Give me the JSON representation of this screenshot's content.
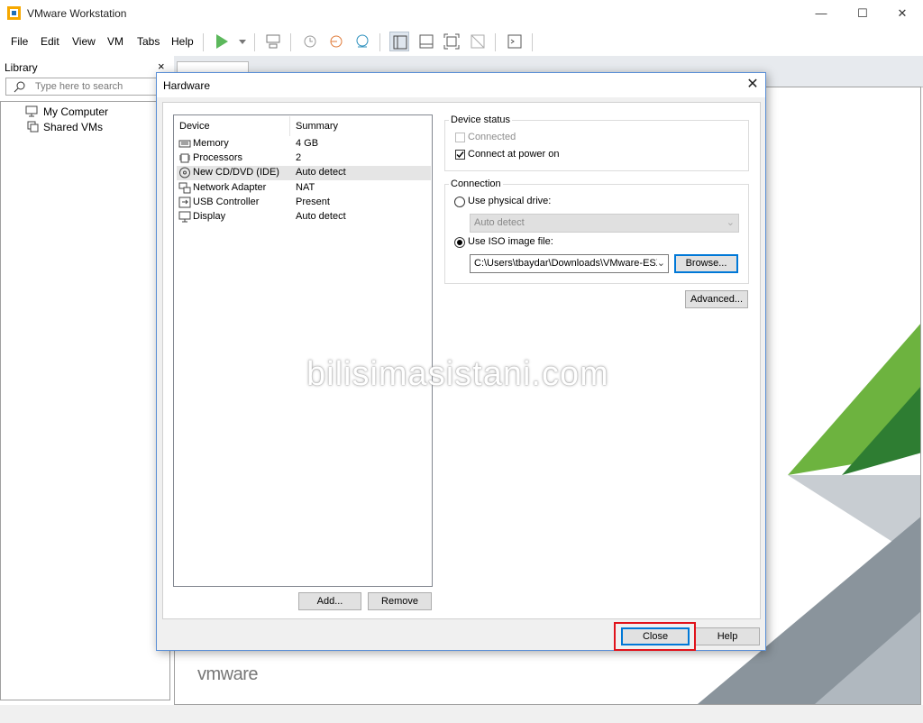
{
  "window": {
    "title": "VMware Workstation",
    "minimize_icon": "minimize-icon",
    "maximize_icon": "maximize-icon",
    "close_icon": "close-icon"
  },
  "menu": [
    "File",
    "Edit",
    "View",
    "VM",
    "Tabs",
    "Help"
  ],
  "library": {
    "title": "Library",
    "close_glyph": "×",
    "search_placeholder": "Type here to search",
    "items": [
      "My Computer",
      "Shared VMs"
    ]
  },
  "main": {
    "logo_text": "vmware",
    "watermark": "bilisimasistani.com",
    "colors": {
      "green_light": "#6db33f",
      "green_dark": "#2e7d32",
      "grey_light": "#c8cdd2",
      "grey_dark": "#8a949c"
    }
  },
  "dialog": {
    "title": "Hardware",
    "close_glyph": "✕",
    "columns": {
      "device": "Device",
      "summary": "Summary"
    },
    "devices": [
      {
        "name": "Memory",
        "summary": "4 GB",
        "icon": "memory-icon",
        "selected": false
      },
      {
        "name": "Processors",
        "summary": "2",
        "icon": "processor-icon",
        "selected": false
      },
      {
        "name": "New CD/DVD (IDE)",
        "summary": "Auto detect",
        "icon": "cd-dvd-icon",
        "selected": true
      },
      {
        "name": "Network Adapter",
        "summary": "NAT",
        "icon": "network-icon",
        "selected": false
      },
      {
        "name": "USB Controller",
        "summary": "Present",
        "icon": "usb-icon",
        "selected": false
      },
      {
        "name": "Display",
        "summary": "Auto detect",
        "icon": "display-icon",
        "selected": false
      }
    ],
    "add_label": "Add...",
    "remove_label": "Remove",
    "device_status": {
      "title": "Device status",
      "connected_label": "Connected",
      "connected_checked": false,
      "connect_power_label": "Connect at power on",
      "connect_power_checked": true
    },
    "connection": {
      "title": "Connection",
      "physical_label": "Use physical drive:",
      "physical_value": "Auto detect",
      "iso_label": "Use ISO image file:",
      "iso_value": "C:\\Users\\tbaydar\\Downloads\\VMware-ESX",
      "selected": "iso",
      "browse_label": "Browse..."
    },
    "advanced_label": "Advanced...",
    "close_label": "Close",
    "help_label": "Help",
    "highlight_color": "#e0131b"
  }
}
